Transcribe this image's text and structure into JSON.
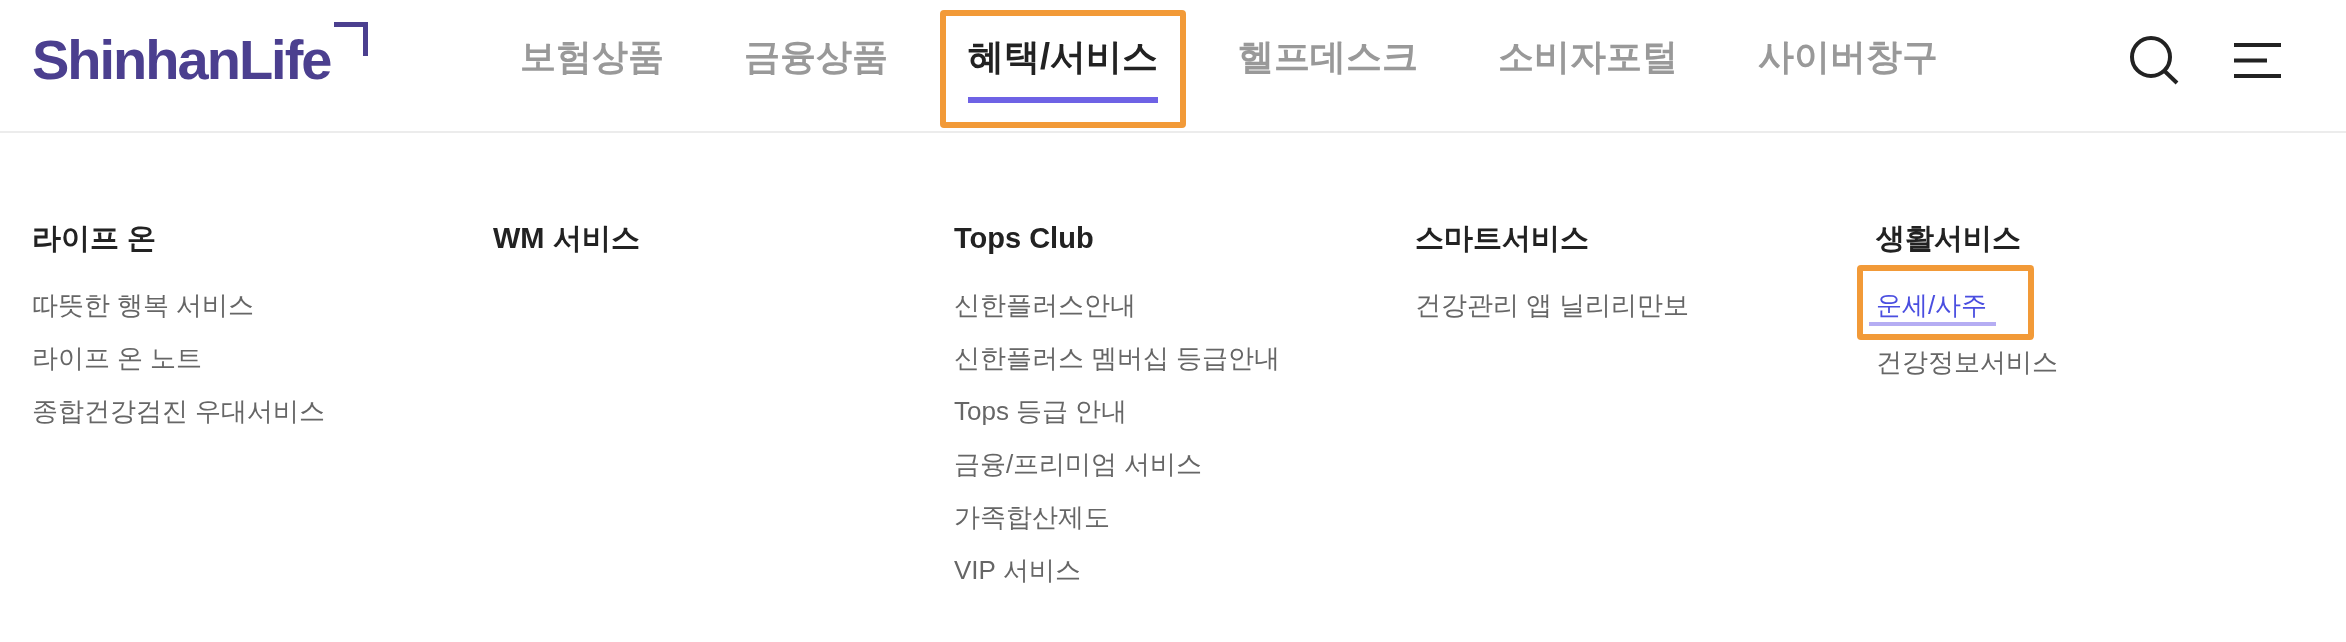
{
  "header": {
    "logo": "ShinhanLife",
    "nav": [
      {
        "label": "보험상품",
        "selected": false,
        "highlighted": false
      },
      {
        "label": "금융상품",
        "selected": false,
        "highlighted": false
      },
      {
        "label": "혜택/서비스",
        "selected": true,
        "highlighted": true
      },
      {
        "label": "헬프데스크",
        "selected": false,
        "highlighted": false
      },
      {
        "label": "소비자포털",
        "selected": false,
        "highlighted": false
      },
      {
        "label": "사이버창구",
        "selected": false,
        "highlighted": false
      }
    ]
  },
  "menu": {
    "columns": [
      {
        "heading": "라이프 온",
        "links": [
          {
            "label": "따뜻한 행복 서비스",
            "selected": false,
            "highlighted": false
          },
          {
            "label": "라이프 온 노트",
            "selected": false,
            "highlighted": false
          },
          {
            "label": "종합건강검진 우대서비스",
            "selected": false,
            "highlighted": false
          }
        ]
      },
      {
        "heading": "WM 서비스"
      },
      {
        "heading": "Tops Club",
        "links": [
          {
            "label": "신한플러스안내",
            "selected": false,
            "highlighted": false
          },
          {
            "label": "신한플러스 멤버십 등급안내",
            "selected": false,
            "highlighted": false
          },
          {
            "label": "Tops 등급 안내",
            "selected": false,
            "highlighted": false
          },
          {
            "label": "금융/프리미엄 서비스",
            "selected": false,
            "highlighted": false
          },
          {
            "label": "가족합산제도",
            "selected": false,
            "highlighted": false
          },
          {
            "label": "VIP 서비스",
            "selected": false,
            "highlighted": false
          }
        ]
      },
      {
        "heading": "스마트서비스",
        "links": [
          {
            "label": "건강관리 앱 닐리리만보",
            "selected": false,
            "highlighted": false
          }
        ]
      },
      {
        "heading": "생활서비스",
        "links": [
          {
            "label": "운세/사주",
            "selected": true,
            "highlighted": true
          },
          {
            "label": "건강정보서비스",
            "selected": false,
            "highlighted": false
          }
        ]
      }
    ]
  }
}
